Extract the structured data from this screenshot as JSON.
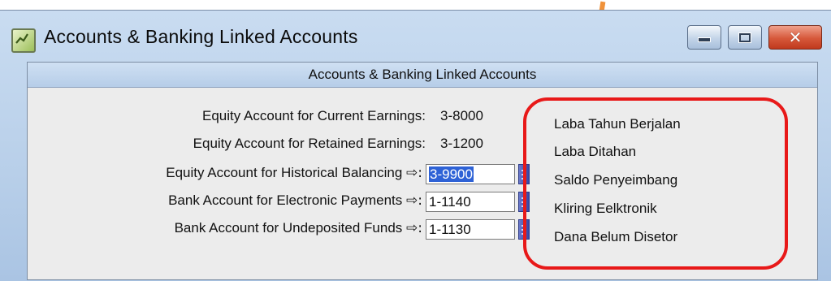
{
  "window": {
    "title": "Accounts & Banking Linked Accounts"
  },
  "panel": {
    "header": "Accounts & Banking Linked Accounts",
    "rows": [
      {
        "label": "Equity Account for Current Earnings:",
        "value": "3-8000",
        "editable": false,
        "translation": "Laba Tahun Berjalan"
      },
      {
        "label": "Equity Account for Retained Earnings:",
        "value": "3-1200",
        "editable": false,
        "translation": "Laba Ditahan"
      },
      {
        "label": "Equity Account for Historical Balancing",
        "value": "3-9900",
        "editable": true,
        "selected": true,
        "translation": "Saldo Penyeimbang"
      },
      {
        "label": "Bank Account for Electronic Payments",
        "value": "1-1140",
        "editable": true,
        "translation": "Kliring Eelktronik"
      },
      {
        "label": "Bank Account for Undeposited Funds",
        "value": "1-1130",
        "editable": true,
        "translation": "Dana Belum Disetor"
      }
    ],
    "arrow_glyph": "⇨:"
  },
  "icons": {
    "app": "accounts-app-icon",
    "minimize": "minimize-icon",
    "maximize": "maximize-icon",
    "close": "close-icon",
    "lookup": "list-lookup-icon"
  },
  "colors": {
    "annotation": "#e81919",
    "pointer": "#f0923a",
    "selection": "#2e62d6"
  }
}
